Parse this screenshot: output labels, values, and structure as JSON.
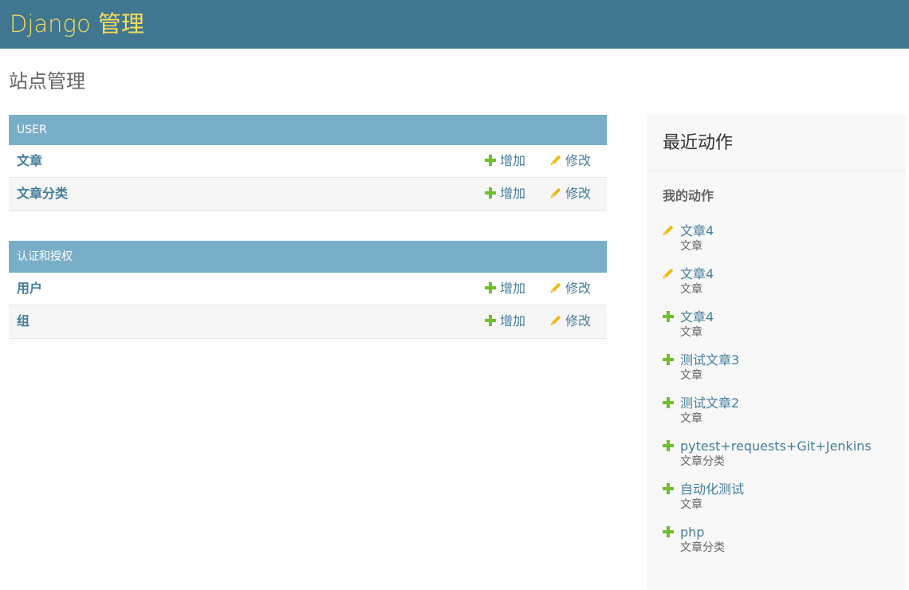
{
  "header": {
    "brand": "Django 管理"
  },
  "page": {
    "title": "站点管理"
  },
  "modules": [
    {
      "caption": "USER",
      "rows": [
        {
          "name": "文章",
          "add": "增加",
          "change": "修改"
        },
        {
          "name": "文章分类",
          "add": "增加",
          "change": "修改"
        }
      ]
    },
    {
      "caption": "认证和授权",
      "rows": [
        {
          "name": "用户",
          "add": "增加",
          "change": "修改"
        },
        {
          "name": "组",
          "add": "增加",
          "change": "修改"
        }
      ]
    }
  ],
  "recent": {
    "title": "最近动作",
    "subtitle": "我的动作",
    "actions": [
      {
        "icon": "pencil-icon",
        "label": "文章4",
        "type": "文章"
      },
      {
        "icon": "pencil-icon",
        "label": "文章4",
        "type": "文章"
      },
      {
        "icon": "plus-icon",
        "label": "文章4",
        "type": "文章"
      },
      {
        "icon": "plus-icon",
        "label": "测试文章3",
        "type": "文章"
      },
      {
        "icon": "plus-icon",
        "label": "测试文章2",
        "type": "文章"
      },
      {
        "icon": "plus-icon",
        "label": "pytest+requests+Git+Jenkins",
        "type": "文章分类"
      },
      {
        "icon": "plus-icon",
        "label": "自动化测试",
        "type": "文章"
      },
      {
        "icon": "plus-icon",
        "label": "php",
        "type": "文章分类"
      }
    ]
  },
  "colors": {
    "header_bg": "#417690",
    "brand": "#f5dd5d",
    "module_caption_bg": "#79aec8",
    "link": "#447e9b",
    "add_icon": "#70bf2b",
    "change_icon": "#efb80b"
  }
}
